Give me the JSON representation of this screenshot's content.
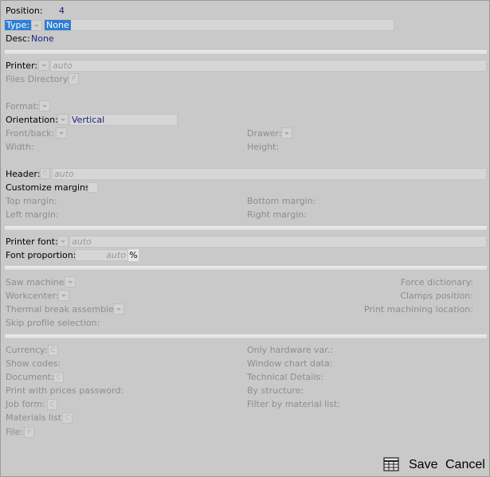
{
  "header": {
    "position_label": "Position:",
    "position_value": "4",
    "type_label": "Type:",
    "type_value": "None",
    "desc_label": "Desc:",
    "desc_value": "None"
  },
  "printer": {
    "printer_label": "Printer:",
    "printer_value": "auto",
    "files_dir_label": "Files Directory:",
    "format_label": "Format:",
    "orientation_label": "Orientation:",
    "orientation_value": "Vertical",
    "front_back_label": "Front/back:",
    "drawer_label": "Drawer:",
    "width_label": "Width:",
    "height_label": "Height:"
  },
  "page": {
    "header_label": "Header:",
    "header_value": "auto",
    "customize_margins_label": "Customize margins:",
    "top_margin_label": "Top margin:",
    "bottom_margin_label": "Bottom margin:",
    "left_margin_label": "Left margin:",
    "right_margin_label": "Right margin:"
  },
  "font": {
    "printer_font_label": "Printer font:",
    "printer_font_value": "auto",
    "font_proportion_label": "Font proportion:",
    "font_proportion_value": "auto",
    "percent_symbol": "%"
  },
  "machine": {
    "saw_label": "Saw machine:",
    "workcenter_label": "Workcenter:",
    "thermal_label": "Thermal break assembler:",
    "skip_label": "Skip profile selection:",
    "force_dict_label": "Force dictionary:",
    "clamps_label": "Clamps position:",
    "print_machining_label": "Print machining location:"
  },
  "misc": {
    "currency_label": "Currency:",
    "show_codes_label": "Show codes:",
    "document_label": "Document:",
    "print_prices_label": "Print with prices password:",
    "job_form_label": "Job form:",
    "materials_list_label": "Materials list:",
    "file_label": "File:",
    "only_hw_label": "Only hardware var.:",
    "window_chart_label": "Window chart data:",
    "tech_details_label": "Technical Details:",
    "by_structure_label": "By structure:",
    "filter_material_label": "Filter by material list:"
  },
  "icons": {
    "c_glyph": "C",
    "p_glyph": "P"
  },
  "footer": {
    "save_label": "Save",
    "cancel_label": "Cancel"
  }
}
